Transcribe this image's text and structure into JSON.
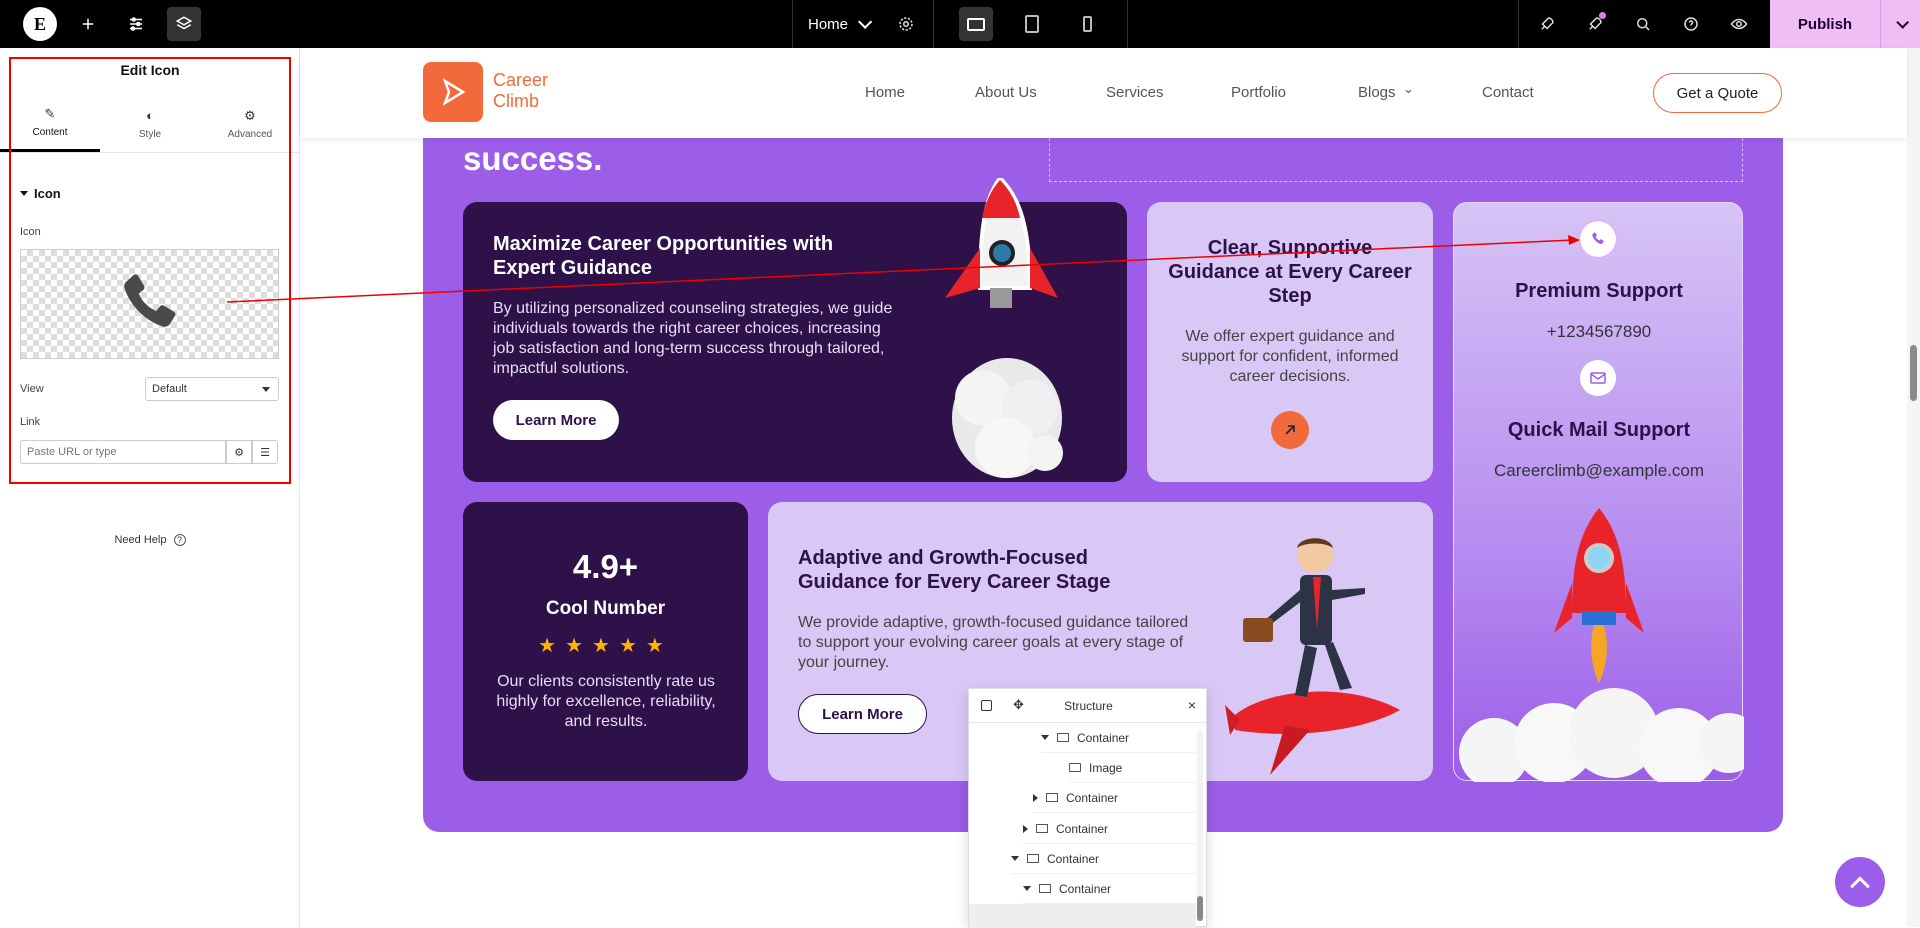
{
  "topbar": {
    "page_name": "Home",
    "publish_label": "Publish"
  },
  "panel": {
    "title": "Edit Icon",
    "tabs": [
      {
        "label": "Content"
      },
      {
        "label": "Style"
      },
      {
        "label": "Advanced"
      }
    ],
    "section_title": "Icon",
    "icon_label": "Icon",
    "view_label": "View",
    "view_value": "Default",
    "link_label": "Link",
    "link_placeholder": "Paste URL or type",
    "need_help": "Need Help"
  },
  "site": {
    "brand_line1": "Career",
    "brand_line2": "Climb",
    "nav": [
      "Home",
      "About Us",
      "Services",
      "Portfolio",
      "Blogs",
      "Contact"
    ],
    "quote_button": "Get a Quote",
    "success_heading": "success."
  },
  "cards": {
    "career": {
      "title": "Maximize Career Opportunities with Expert Guidance",
      "text": "By utilizing personalized counseling strategies, we guide individuals towards the right career choices, increasing job satisfaction and long-term success through tailored, impactful solutions.",
      "button": "Learn More"
    },
    "clear": {
      "title": "Clear, Supportive Guidance at Every Career Step",
      "text": "We offer expert guidance and support for confident, informed career decisions."
    },
    "support": {
      "title1": "Premium Support",
      "phone": "+1234567890",
      "title2": "Quick Mail Support",
      "email": "Careerclimb@example.com"
    },
    "rating": {
      "number": "4.9+",
      "label": "Cool Number",
      "stars": 5,
      "text": "Our clients consistently rate us highly for excellence, reliability, and results."
    },
    "adaptive": {
      "title": "Adaptive and Growth-Focused Guidance for Every Career Stage",
      "text": "We provide adaptive, growth-focused guidance tailored to support your evolving career goals at every stage of your journey.",
      "button": "Learn More"
    }
  },
  "structure": {
    "title": "Structure",
    "rows": [
      "Container",
      "Image",
      "Container",
      "Container",
      "Container",
      "Container"
    ]
  },
  "colors": {
    "accent_orange": "#f26a3b",
    "purple": "#9c5de8",
    "dark_purple": "#2d1148",
    "light_purple": "#d9c8f5",
    "publish": "#f0bdf5"
  }
}
